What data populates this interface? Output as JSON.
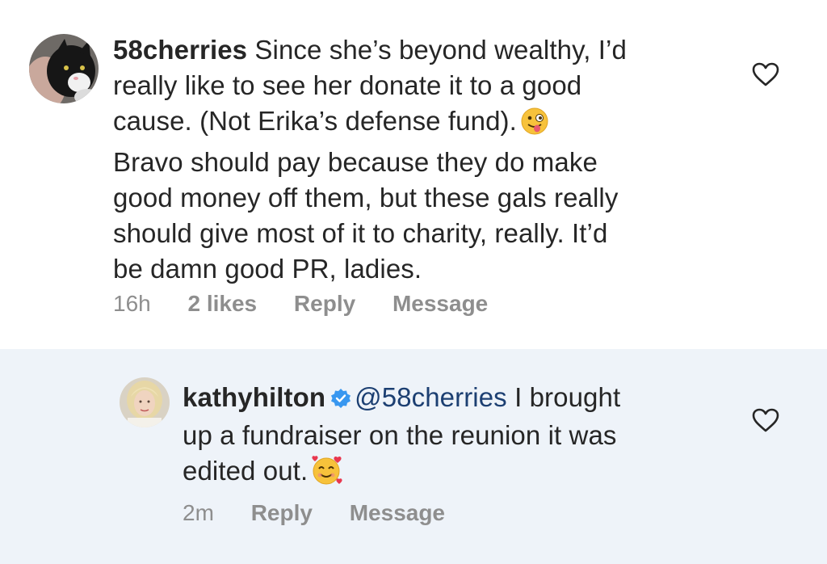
{
  "comments": [
    {
      "username": "58cherries",
      "text_lines": [
        "Since she’s beyond wealthy, I’d",
        "really like to see her donate it to a good",
        "cause. (Not Erika’s defense fund).",
        "Bravo should pay because they do make",
        "good money off them, but these gals really",
        "should give most of it to charity, really.  It’d",
        "be damn good PR, ladies."
      ],
      "emoji": "winking-face-with-tongue",
      "time": "16h",
      "likes": "2 likes",
      "reply_label": "Reply",
      "message_label": "Message",
      "avatar": "cat-avatar",
      "like_icon": "heart-outline"
    },
    {
      "username": "kathyhilton",
      "verified": true,
      "mention": "@58cherries",
      "text_after_mention": " I brought",
      "text_lines": [
        "up a fundraiser on the reunion it was",
        "edited out."
      ],
      "emoji": "smiling-face-with-hearts",
      "time": "2m",
      "reply_label": "Reply",
      "message_label": "Message",
      "avatar": "person-avatar",
      "like_icon": "heart-outline",
      "highlight_color": "#eef3f9"
    }
  ],
  "colors": {
    "text": "#262626",
    "meta": "#8e8e8e",
    "mention": "#1c3f72",
    "verified": "#3897f0"
  }
}
